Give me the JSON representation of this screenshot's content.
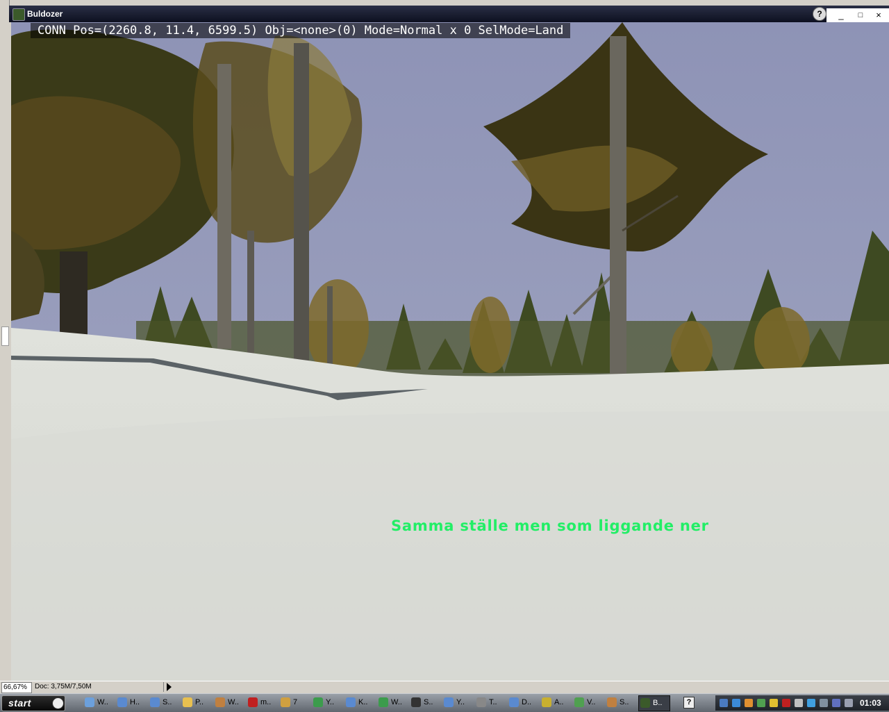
{
  "window": {
    "title": "Buldozer",
    "help_glyph": "?",
    "minimize_glyph": "_",
    "maximize_glyph": "□",
    "close_glyph": "×"
  },
  "viewport": {
    "status_line": "CONN Pos=(2260.8, 11.4, 6599.5) Obj=<none>(0) Mode=Normal x 0 SelMode=Land",
    "caption": "Samma ställe men som liggande ner",
    "caption_color": "#22ee66"
  },
  "ps_status": {
    "zoom": "66,67%",
    "doc": "Doc: 3,75M/7,50M"
  },
  "taskbar": {
    "start_label": "start",
    "tasks": [
      {
        "label": "W..",
        "icon": "windows-explorer-icon",
        "color": "#6ca0dc"
      },
      {
        "label": "H..",
        "icon": "network-icon",
        "color": "#5a8ad0"
      },
      {
        "label": "S..",
        "icon": "network-icon",
        "color": "#5a8ad0"
      },
      {
        "label": "P..",
        "icon": "folder-icon",
        "color": "#e8c050"
      },
      {
        "label": "W..",
        "icon": "archive-icon",
        "color": "#c08040"
      },
      {
        "label": "m..",
        "icon": "app-icon",
        "color": "#c02020"
      },
      {
        "label": "7",
        "icon": "tool-icon",
        "color": "#d0a040"
      },
      {
        "label": "Y..",
        "icon": "chrome-icon",
        "color": "#3c9c4c"
      },
      {
        "label": "K..",
        "icon": "network-icon",
        "color": "#5a8ad0"
      },
      {
        "label": "W..",
        "icon": "chrome-icon",
        "color": "#3c9c4c"
      },
      {
        "label": "S..",
        "icon": "steam-icon",
        "color": "#333333"
      },
      {
        "label": "Y..",
        "icon": "network-icon",
        "color": "#5a8ad0"
      },
      {
        "label": "T..",
        "icon": "app-icon",
        "color": "#888888"
      },
      {
        "label": "D..",
        "icon": "network-icon",
        "color": "#5a8ad0"
      },
      {
        "label": "A..",
        "icon": "pencil-icon",
        "color": "#c8b030"
      },
      {
        "label": "V..",
        "icon": "check-icon",
        "color": "#50a050"
      },
      {
        "label": "S..",
        "icon": "archive-icon",
        "color": "#c08040"
      },
      {
        "label": "B..",
        "icon": "buldozer-icon",
        "color": "#3b5a2a"
      }
    ],
    "quick_help_glyph": "?",
    "clock": "01:03"
  }
}
